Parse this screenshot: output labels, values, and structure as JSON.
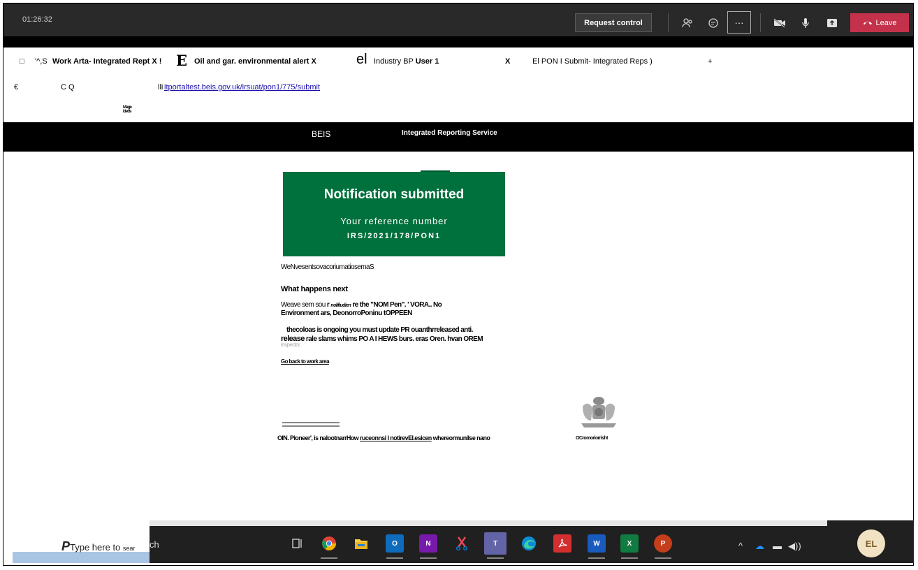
{
  "meeting": {
    "timer": "01:26:32",
    "request_control_label": "Request control",
    "more_label": "···",
    "leave_label": "Leave",
    "icons": [
      "participants-icon",
      "chat-icon",
      "more-icon",
      "camera-off-icon",
      "mic-icon",
      "share-icon",
      "leave-phone-icon"
    ]
  },
  "browser": {
    "tabs": [
      {
        "icon": "□",
        "label": "'^,S"
      },
      {
        "label": "Work Arta- Integrated Rept X !"
      },
      {
        "icon": "E"
      },
      {
        "label": "Oil and gar. environmental alert X"
      },
      {
        "icon": "el"
      },
      {
        "label_plain": "Industry BP",
        "label_bold": "User 1"
      },
      {
        "close": "X"
      },
      {
        "label": "El PON I Submit- Integrated Reps )"
      },
      {
        "add": "+"
      }
    ],
    "nav_back": "€",
    "nav_cq": "C Q",
    "url_prefix": "lli",
    "url": "itportaltest.beis.gov.uk/irsuat/pon1/775/submit",
    "bookmark_line1": "Mage",
    "bookmark_line2": "ldeds"
  },
  "site": {
    "beis": "BEIS",
    "service": "Integrated Reporting Service"
  },
  "panel": {
    "title": "Notification submitted",
    "subtitle": "Your reference number",
    "reference": "IRS/2021/178/PON1"
  },
  "content": {
    "line1": "WeNvesentsovacoriumatiosernaS",
    "what_next": "What happens next",
    "p1a": "Weave sem sou ",
    "p1b": "r ",
    "p1c": "nolifiudien",
    "p1d": " re the \"NOM Pen\". ' VORA.. No",
    "p1e": "Environment ars, DeonorroPoninu tOPPEEN",
    "p2a": "thecoloas is ongoing you must update PR ouanthrreleased anti.",
    "p2b": "release",
    "p2c": " rale slams whims PO A I HEWS burs. eras Oren. hvan OREM",
    "p2d": "inspector.",
    "back_link": "Go back to work area",
    "footer_a": "OIN. Pioneer', is nalootnarrHow ",
    "footer_link": "ruceonnsi I notirevEl.esicen",
    "footer_b": " whereormunilse nano",
    "copyright": "OCromoriorrisht"
  },
  "taskbar": {
    "search_p": "P",
    "search_placeholder": "Type here to ",
    "search_small": "sear",
    "search_tail": "ch",
    "apps": [
      "task-view-icon",
      "chrome-icon",
      "file-explorer-icon",
      "outlook-icon",
      "onenote-icon",
      "snipping-icon",
      "teams-icon",
      "edge-icon",
      "acrobat-icon",
      "word-icon",
      "excel-icon",
      "powerpoint-icon"
    ],
    "avatar_initials": "EL"
  }
}
